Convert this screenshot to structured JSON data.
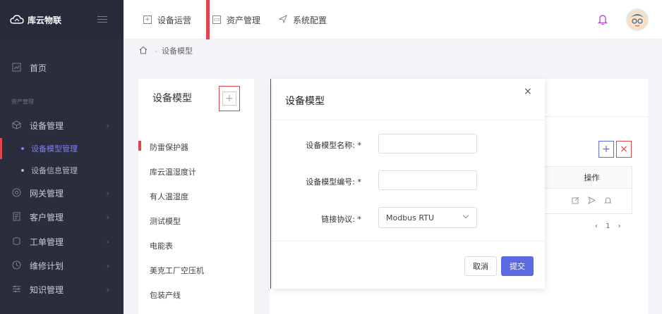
{
  "brand": {
    "name": "库云物联"
  },
  "sidebar": {
    "items": [
      {
        "label": "首页",
        "icon": "chart-icon"
      }
    ],
    "group_label": "资产管理",
    "groups": [
      {
        "label": "设备管理",
        "icon": "cube-icon"
      },
      {
        "label": "网关管理",
        "icon": "gateway-icon"
      },
      {
        "label": "客户管理",
        "icon": "document-icon"
      },
      {
        "label": "工单管理",
        "icon": "ticket-icon"
      },
      {
        "label": "维修计划",
        "icon": "plan-icon"
      },
      {
        "label": "知识管理",
        "icon": "knowledge-icon"
      }
    ],
    "sub_items": [
      {
        "label": "设备模型管理"
      },
      {
        "label": "设备信息管理"
      }
    ]
  },
  "header": {
    "tabs": [
      {
        "label": "设备运营"
      },
      {
        "label": "资产管理"
      },
      {
        "label": "系统配置"
      }
    ]
  },
  "breadcrumb": {
    "current": "设备模型"
  },
  "model_panel": {
    "title": "设备模型",
    "items": [
      "防雷保护器",
      "库云温湿度计",
      "有人温湿度",
      "测试模型",
      "电能表",
      "美克工厂空压机",
      "包装产线"
    ]
  },
  "table": {
    "column_ops": "操作",
    "pagination": "‹ 1 ›"
  },
  "modal": {
    "title": "设备模型",
    "close": "×",
    "fields": {
      "name_label": "设备模型名称: *",
      "code_label": "设备模型编号: *",
      "protocol_label": "链接协议: *",
      "protocol_value": "Modbus RTU"
    },
    "cancel": "取消",
    "submit": "提交"
  },
  "colors": {
    "accent": "#e0464d",
    "primary": "#5b6ae0",
    "sidebar_bg": "#2a2d3c",
    "active_sub": "#7f7ff7"
  }
}
